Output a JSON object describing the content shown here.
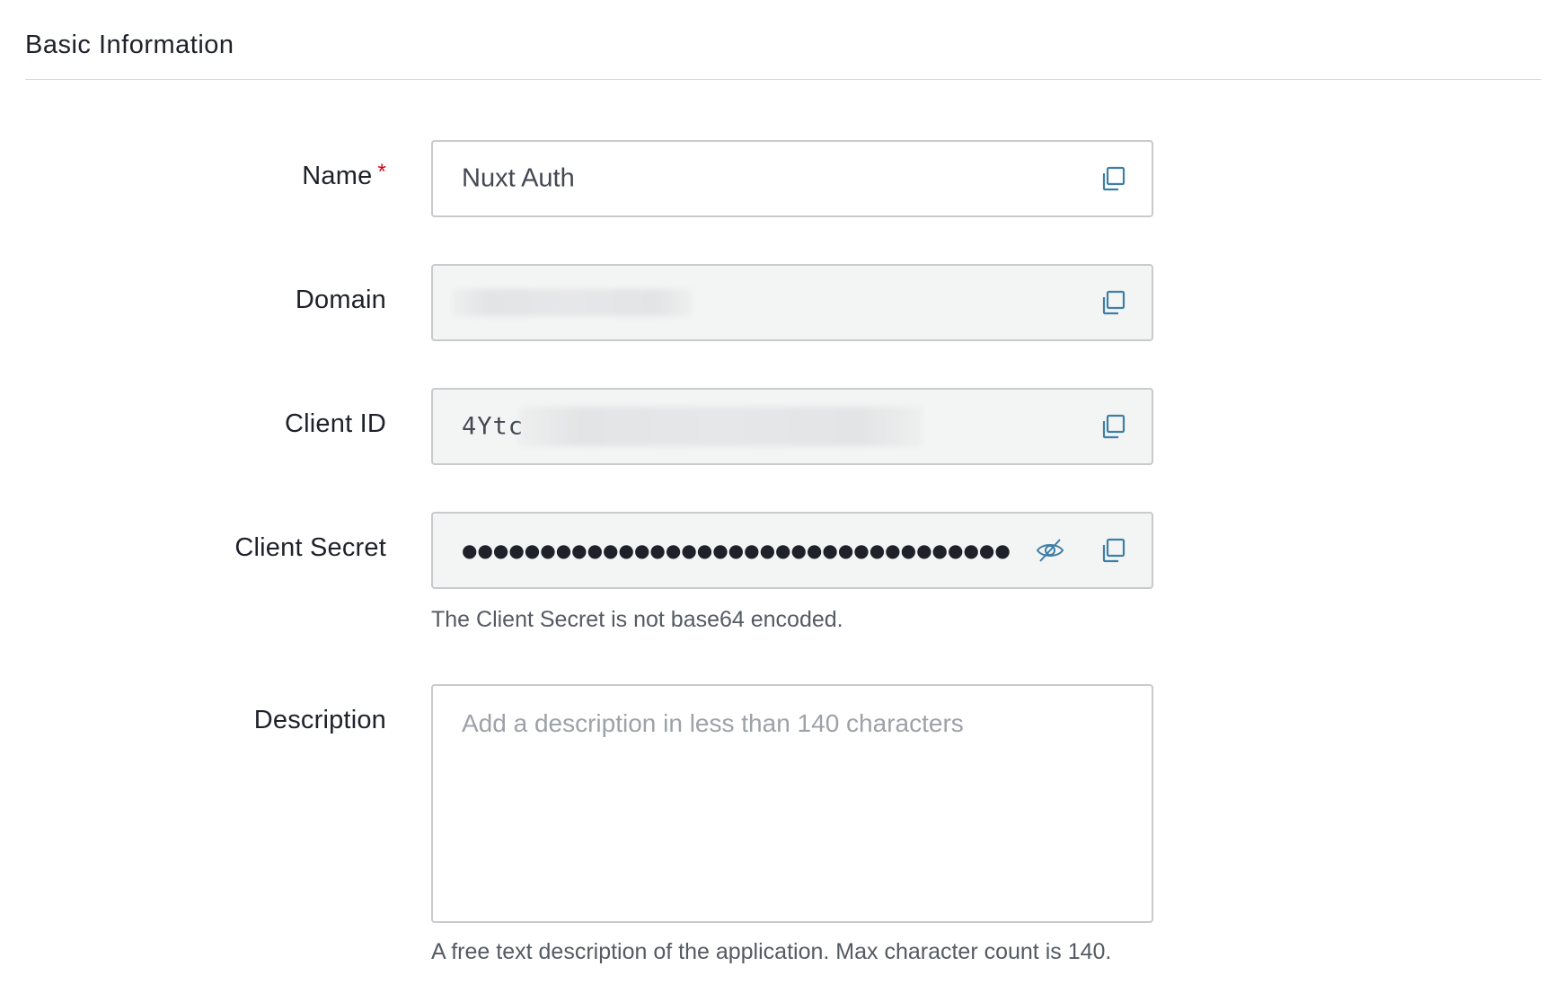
{
  "section": {
    "title": "Basic Information"
  },
  "fields": {
    "name": {
      "label": "Name",
      "required_mark": "*",
      "value": "Nuxt Auth",
      "copy_icon": "copy-icon"
    },
    "domain": {
      "label": "Domain",
      "value": "",
      "copy_icon": "copy-icon"
    },
    "client_id": {
      "label": "Client ID",
      "value_visible_prefix": "4Ytc",
      "copy_icon": "copy-icon"
    },
    "client_secret": {
      "label": "Client Secret",
      "masked_value": "●●●●●●●●●●●●●●●●●●●●●●●●●●●●●●●●●●●●●●●●●●●●●●●●●●●●●●●●●●●●",
      "toggle_icon": "eye-slash-icon",
      "copy_icon": "copy-icon",
      "help": "The Client Secret is not base64 encoded."
    },
    "description": {
      "label": "Description",
      "placeholder": "Add a description in less than 140 characters",
      "help": "A free text description of the application. Max character count is 140."
    }
  },
  "colors": {
    "accent": "#3f7fa5",
    "required": "#d0021b",
    "readonly_bg": "#f3f4f4",
    "border": "#c9cace"
  }
}
